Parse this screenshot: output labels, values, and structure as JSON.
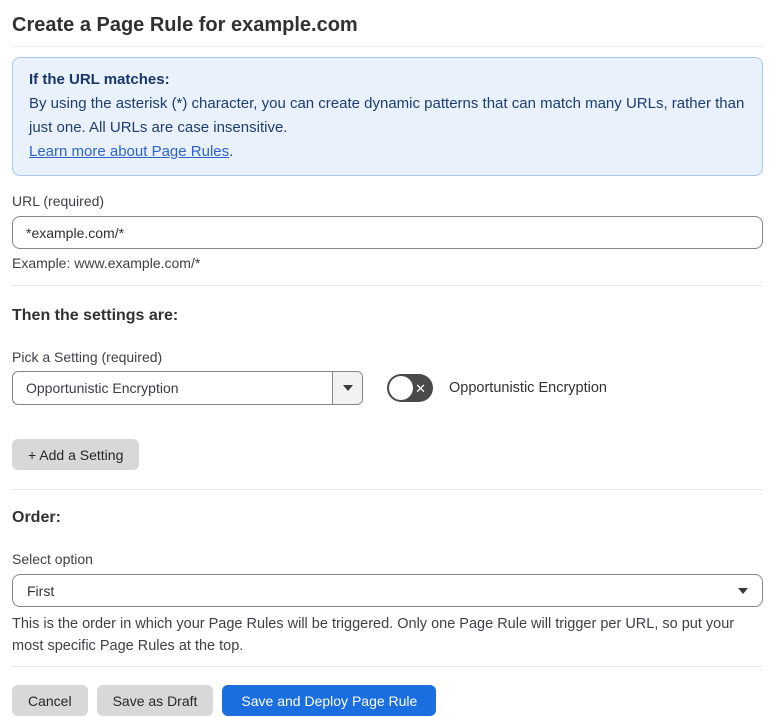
{
  "page": {
    "title": "Create a Page Rule for example.com"
  },
  "info_box": {
    "heading": "If the URL matches:",
    "body": "By using the asterisk (*) character, you can create dynamic patterns that can match many URLs, rather than just one. All URLs are case insensitive.",
    "link_label": "Learn more about Page Rules",
    "link_suffix": "."
  },
  "url_field": {
    "label": "URL (required)",
    "value": "*example.com/*",
    "helper": "Example: www.example.com/*"
  },
  "settings_section": {
    "heading": "Then the settings are:",
    "picker_label": "Pick a Setting (required)",
    "picker_value": "Opportunistic Encryption",
    "toggle_state": "off",
    "toggle_icon": "✕",
    "toggle_label": "Opportunistic Encryption",
    "add_button_label": "+ Add a Setting"
  },
  "order_section": {
    "heading": "Order:",
    "select_label": "Select option",
    "select_value": "First",
    "helper": "This is the order in which your Page Rules will be triggered. Only one Page Rule will trigger per URL, so put your most specific Page Rules at the top."
  },
  "footer": {
    "cancel_label": "Cancel",
    "save_draft_label": "Save as Draft",
    "save_deploy_label": "Save and Deploy Page Rule"
  },
  "colors": {
    "accent_blue": "#1a6ee0",
    "info_background": "#e9f2fc",
    "info_border": "#a8c7e9",
    "info_text": "#1e3c71",
    "link_blue": "#2c62cb",
    "toggle_off_background": "#4a4a4a",
    "gray_button_background": "#d8d8d8"
  }
}
